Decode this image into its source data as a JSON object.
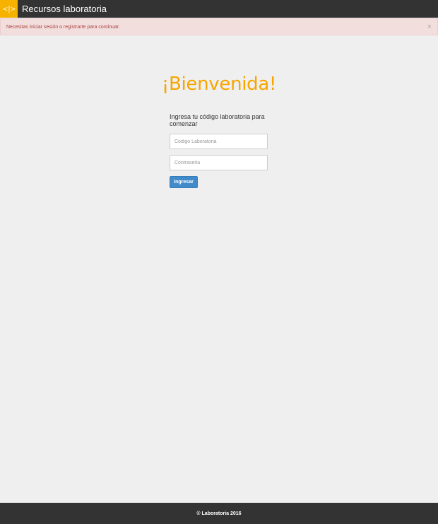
{
  "navbar": {
    "logo_glyph": "<|>",
    "brand": "Recursos laboratoria"
  },
  "alert": {
    "message": "Necesitas iniciar sesión o registrarte para continuar.",
    "close": "×"
  },
  "login": {
    "heading": "¡Bienvenida!",
    "prompt": "Ingresa tu código laboratoria para comenzar",
    "code_placeholder": "Código Laboratoria",
    "code_value": "",
    "password_placeholder": "Contraseña",
    "password_value": "",
    "submit_label": "Ingresar"
  },
  "footer": {
    "text": "© Laboratoria 2016"
  },
  "colors": {
    "navbar_bg": "#333333",
    "logo_bg": "#f7b200",
    "heading": "#f7a600",
    "alert_bg": "#f3dede",
    "alert_text": "#a94442",
    "button_bg": "#428bca"
  },
  "icons": {
    "logo": "code-brackets-icon",
    "close": "close-icon"
  }
}
